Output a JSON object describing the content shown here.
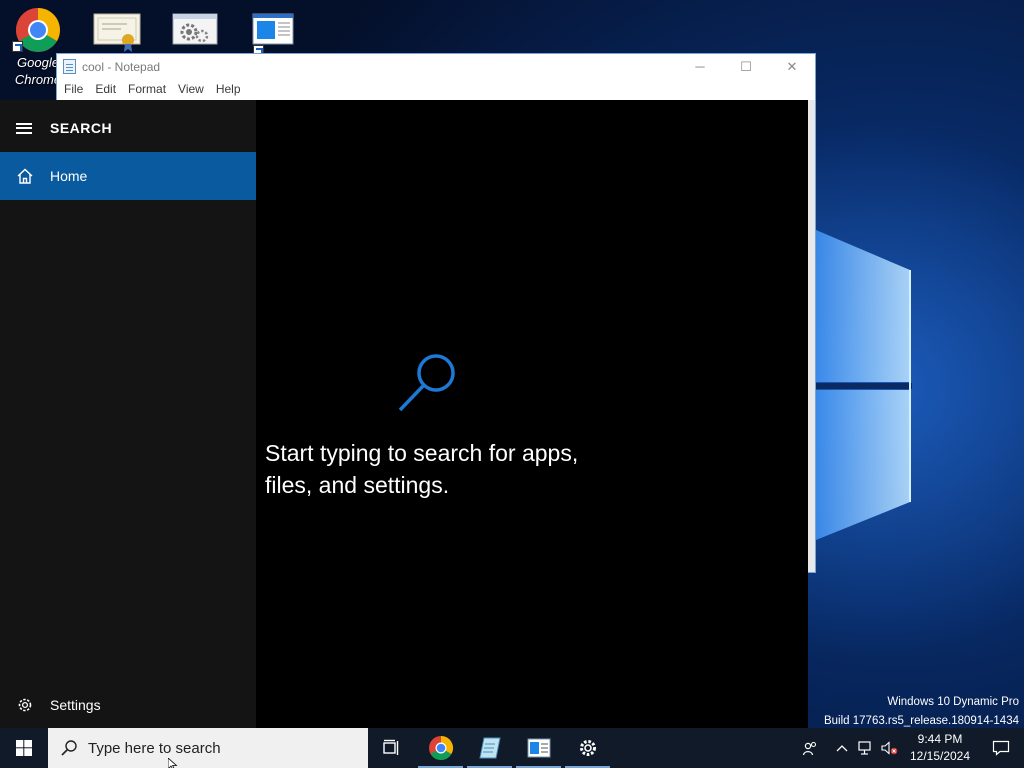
{
  "desktop": {
    "icons": [
      {
        "label": "Google Chrome",
        "icon": "chrome-icon"
      },
      {
        "label": "",
        "icon": "certificate-icon"
      },
      {
        "label": "",
        "icon": "settings-app-icon"
      },
      {
        "label": "",
        "icon": "window-app-icon"
      }
    ],
    "watermark": {
      "line1": "Windows 10 Dynamic Pro",
      "line2": "Build 17763.rs5_release.180914-1434"
    }
  },
  "notepad": {
    "title": "cool - Notepad",
    "menu": [
      "File",
      "Edit",
      "Format",
      "View",
      "Help"
    ],
    "controls": {
      "minimize": "─",
      "maximize": "☐",
      "close": "✕"
    }
  },
  "search_panel": {
    "header": "SEARCH",
    "home_label": "Home",
    "settings_label": "Settings",
    "hint": "Start typing to search for apps, files, and settings.",
    "accent": "#0a5aa0"
  },
  "taskbar": {
    "search_placeholder": "Type here to search",
    "apps": [
      {
        "name": "task-view-icon",
        "running": false
      },
      {
        "name": "chrome-icon",
        "running": true
      },
      {
        "name": "notepad-icon",
        "running": true
      },
      {
        "name": "window-app-icon",
        "running": true
      },
      {
        "name": "settings-icon",
        "running": true
      }
    ],
    "clock": {
      "time": "9:44 PM",
      "date": "12/15/2024"
    }
  }
}
